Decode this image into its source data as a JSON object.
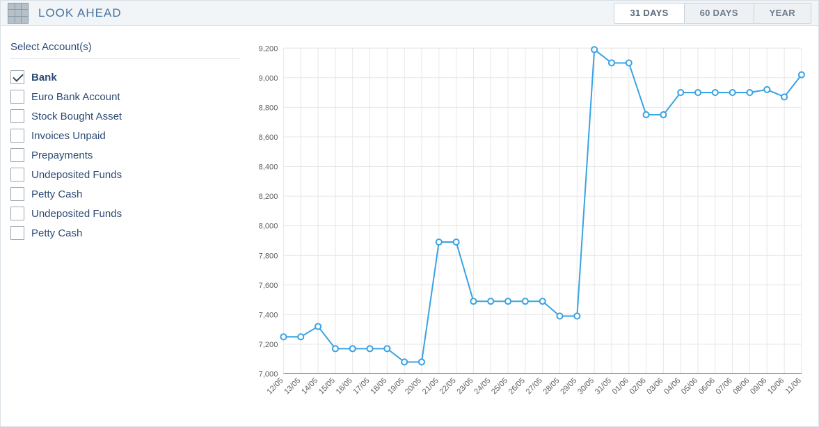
{
  "header": {
    "title": "LOOK AHEAD",
    "ranges": [
      {
        "label": "31 DAYS",
        "active": true
      },
      {
        "label": "60 DAYS",
        "active": false
      },
      {
        "label": "YEAR",
        "active": false
      }
    ]
  },
  "sidebar": {
    "title": "Select Account(s)",
    "accounts": [
      {
        "label": "Bank",
        "checked": true
      },
      {
        "label": "Euro Bank Account",
        "checked": false
      },
      {
        "label": "Stock Bought Asset",
        "checked": false
      },
      {
        "label": "Invoices Unpaid",
        "checked": false
      },
      {
        "label": "Prepayments",
        "checked": false
      },
      {
        "label": "Undeposited Funds",
        "checked": false
      },
      {
        "label": "Petty Cash",
        "checked": false
      },
      {
        "label": "Undeposited Funds",
        "checked": false
      },
      {
        "label": "Petty Cash",
        "checked": false
      }
    ]
  },
  "chart_data": {
    "type": "line",
    "xlabel": "",
    "ylabel": "",
    "ylim": [
      7000,
      9200
    ],
    "yticks": [
      7000,
      7200,
      7400,
      7600,
      7800,
      8000,
      8200,
      8400,
      8600,
      8800,
      9000,
      9200
    ],
    "categories": [
      "12/05",
      "13/05",
      "14/05",
      "15/05",
      "16/05",
      "17/05",
      "18/05",
      "19/05",
      "20/05",
      "21/05",
      "22/05",
      "23/05",
      "24/05",
      "25/05",
      "26/05",
      "27/05",
      "28/05",
      "29/05",
      "30/05",
      "31/05",
      "01/06",
      "02/06",
      "03/06",
      "04/06",
      "05/06",
      "06/06",
      "07/06",
      "08/06",
      "09/06",
      "10/06",
      "11/06"
    ],
    "series": [
      {
        "name": "Bank",
        "color": "#3aa3e3",
        "values": [
          7250,
          7250,
          7320,
          7170,
          7170,
          7170,
          7170,
          7080,
          7080,
          7890,
          7890,
          7490,
          7490,
          7490,
          7490,
          7490,
          7390,
          7390,
          9190,
          9100,
          9100,
          8750,
          8750,
          8900,
          8900,
          8900,
          8900,
          8900,
          8920,
          8870,
          9020
        ]
      }
    ]
  }
}
